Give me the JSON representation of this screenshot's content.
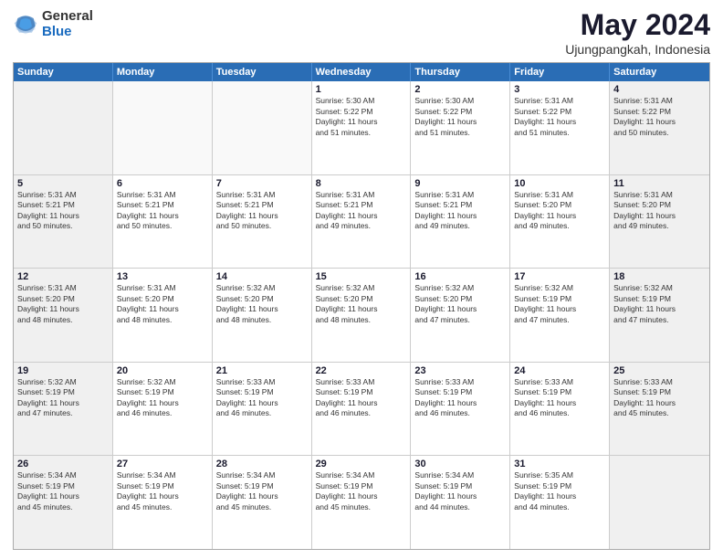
{
  "logo": {
    "general": "General",
    "blue": "Blue"
  },
  "header": {
    "month": "May 2024",
    "location": "Ujungpangkah, Indonesia"
  },
  "days_of_week": [
    "Sunday",
    "Monday",
    "Tuesday",
    "Wednesday",
    "Thursday",
    "Friday",
    "Saturday"
  ],
  "weeks": [
    [
      {
        "day": "",
        "info": ""
      },
      {
        "day": "",
        "info": ""
      },
      {
        "day": "",
        "info": ""
      },
      {
        "day": "1",
        "info": "Sunrise: 5:30 AM\nSunset: 5:22 PM\nDaylight: 11 hours\nand 51 minutes."
      },
      {
        "day": "2",
        "info": "Sunrise: 5:30 AM\nSunset: 5:22 PM\nDaylight: 11 hours\nand 51 minutes."
      },
      {
        "day": "3",
        "info": "Sunrise: 5:31 AM\nSunset: 5:22 PM\nDaylight: 11 hours\nand 51 minutes."
      },
      {
        "day": "4",
        "info": "Sunrise: 5:31 AM\nSunset: 5:22 PM\nDaylight: 11 hours\nand 50 minutes."
      }
    ],
    [
      {
        "day": "5",
        "info": "Sunrise: 5:31 AM\nSunset: 5:21 PM\nDaylight: 11 hours\nand 50 minutes."
      },
      {
        "day": "6",
        "info": "Sunrise: 5:31 AM\nSunset: 5:21 PM\nDaylight: 11 hours\nand 50 minutes."
      },
      {
        "day": "7",
        "info": "Sunrise: 5:31 AM\nSunset: 5:21 PM\nDaylight: 11 hours\nand 50 minutes."
      },
      {
        "day": "8",
        "info": "Sunrise: 5:31 AM\nSunset: 5:21 PM\nDaylight: 11 hours\nand 49 minutes."
      },
      {
        "day": "9",
        "info": "Sunrise: 5:31 AM\nSunset: 5:21 PM\nDaylight: 11 hours\nand 49 minutes."
      },
      {
        "day": "10",
        "info": "Sunrise: 5:31 AM\nSunset: 5:20 PM\nDaylight: 11 hours\nand 49 minutes."
      },
      {
        "day": "11",
        "info": "Sunrise: 5:31 AM\nSunset: 5:20 PM\nDaylight: 11 hours\nand 49 minutes."
      }
    ],
    [
      {
        "day": "12",
        "info": "Sunrise: 5:31 AM\nSunset: 5:20 PM\nDaylight: 11 hours\nand 48 minutes."
      },
      {
        "day": "13",
        "info": "Sunrise: 5:31 AM\nSunset: 5:20 PM\nDaylight: 11 hours\nand 48 minutes."
      },
      {
        "day": "14",
        "info": "Sunrise: 5:32 AM\nSunset: 5:20 PM\nDaylight: 11 hours\nand 48 minutes."
      },
      {
        "day": "15",
        "info": "Sunrise: 5:32 AM\nSunset: 5:20 PM\nDaylight: 11 hours\nand 48 minutes."
      },
      {
        "day": "16",
        "info": "Sunrise: 5:32 AM\nSunset: 5:20 PM\nDaylight: 11 hours\nand 47 minutes."
      },
      {
        "day": "17",
        "info": "Sunrise: 5:32 AM\nSunset: 5:19 PM\nDaylight: 11 hours\nand 47 minutes."
      },
      {
        "day": "18",
        "info": "Sunrise: 5:32 AM\nSunset: 5:19 PM\nDaylight: 11 hours\nand 47 minutes."
      }
    ],
    [
      {
        "day": "19",
        "info": "Sunrise: 5:32 AM\nSunset: 5:19 PM\nDaylight: 11 hours\nand 47 minutes."
      },
      {
        "day": "20",
        "info": "Sunrise: 5:32 AM\nSunset: 5:19 PM\nDaylight: 11 hours\nand 46 minutes."
      },
      {
        "day": "21",
        "info": "Sunrise: 5:33 AM\nSunset: 5:19 PM\nDaylight: 11 hours\nand 46 minutes."
      },
      {
        "day": "22",
        "info": "Sunrise: 5:33 AM\nSunset: 5:19 PM\nDaylight: 11 hours\nand 46 minutes."
      },
      {
        "day": "23",
        "info": "Sunrise: 5:33 AM\nSunset: 5:19 PM\nDaylight: 11 hours\nand 46 minutes."
      },
      {
        "day": "24",
        "info": "Sunrise: 5:33 AM\nSunset: 5:19 PM\nDaylight: 11 hours\nand 46 minutes."
      },
      {
        "day": "25",
        "info": "Sunrise: 5:33 AM\nSunset: 5:19 PM\nDaylight: 11 hours\nand 45 minutes."
      }
    ],
    [
      {
        "day": "26",
        "info": "Sunrise: 5:34 AM\nSunset: 5:19 PM\nDaylight: 11 hours\nand 45 minutes."
      },
      {
        "day": "27",
        "info": "Sunrise: 5:34 AM\nSunset: 5:19 PM\nDaylight: 11 hours\nand 45 minutes."
      },
      {
        "day": "28",
        "info": "Sunrise: 5:34 AM\nSunset: 5:19 PM\nDaylight: 11 hours\nand 45 minutes."
      },
      {
        "day": "29",
        "info": "Sunrise: 5:34 AM\nSunset: 5:19 PM\nDaylight: 11 hours\nand 45 minutes."
      },
      {
        "day": "30",
        "info": "Sunrise: 5:34 AM\nSunset: 5:19 PM\nDaylight: 11 hours\nand 44 minutes."
      },
      {
        "day": "31",
        "info": "Sunrise: 5:35 AM\nSunset: 5:19 PM\nDaylight: 11 hours\nand 44 minutes."
      },
      {
        "day": "",
        "info": ""
      }
    ]
  ]
}
